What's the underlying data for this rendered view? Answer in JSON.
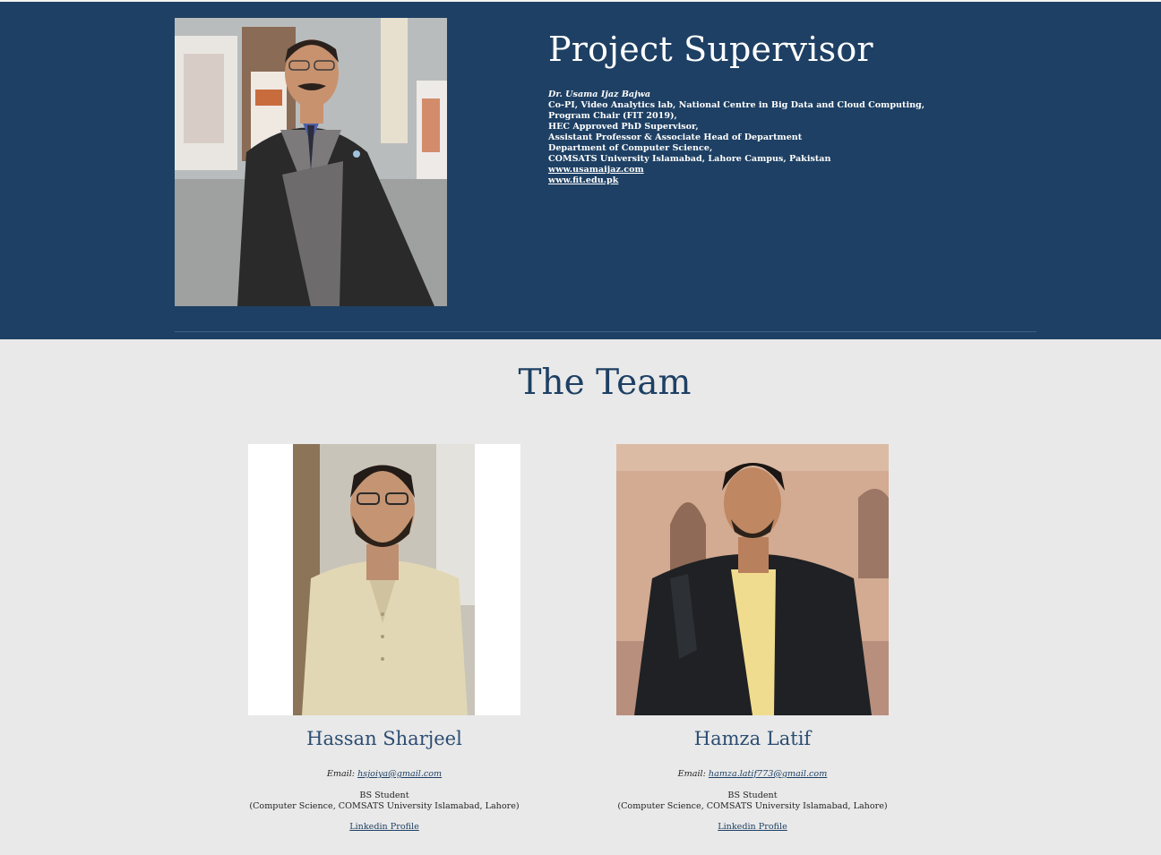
{
  "supervisor": {
    "title": "Project Supervisor",
    "lines": [
      "Dr. Usama Ijaz Bajwa",
      "Co-PI, Video Analytics lab, National Centre in Big Data and Cloud Computing,",
      "Program Chair (FIT 2019),",
      "HEC Approved PhD Supervisor,",
      "Assistant Professor & Associate Head of Department",
      "Department of Computer Science,",
      "COMSATS University Islamabad, Lahore Campus, Pakistan"
    ],
    "links": [
      "www.usamaijaz.com",
      "www.fit.edu.pk"
    ]
  },
  "team": {
    "heading": "The Team",
    "members": [
      {
        "name": "Hassan Sharjeel",
        "email_label": "Email: ",
        "email": "hsjoiya@gmail.com",
        "role": "BS Student",
        "affiliation": "(Computer Science, COMSATS University Islamabad, Lahore)",
        "link_label": "Linkedin Profile"
      },
      {
        "name": "Hamza Latif",
        "email_label": "Email: ",
        "email": "hamza.latif773@gmail.com",
        "role": "BS Student",
        "affiliation": "(Computer Science, COMSATS University Islamabad, Lahore)",
        "link_label": "Linkedin Profile"
      }
    ]
  },
  "colors": {
    "hero_bg": "#1e4064",
    "page_bg": "#e9e9e9",
    "accent": "#2b4d73"
  }
}
